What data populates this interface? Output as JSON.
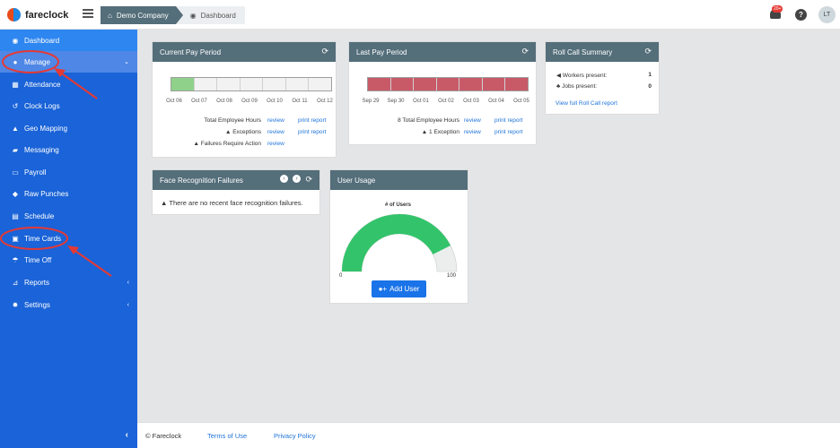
{
  "app": {
    "name": "fareclock"
  },
  "breadcrumb": {
    "company": "Demo Company",
    "page": "Dashboard"
  },
  "header": {
    "notification_count": "20+",
    "help_label": "?",
    "user_initials": "LT"
  },
  "sidebar": {
    "items": [
      {
        "label": "Dashboard",
        "icon": "dashboard-icon"
      },
      {
        "label": "Manage",
        "icon": "user-icon",
        "caret": "⌄"
      },
      {
        "label": "Attendance",
        "icon": "attendance-icon"
      },
      {
        "label": "Clock Logs",
        "icon": "history-icon"
      },
      {
        "label": "Geo Mapping",
        "icon": "map-icon"
      },
      {
        "label": "Messaging",
        "icon": "chat-icon"
      },
      {
        "label": "Payroll",
        "icon": "payroll-icon"
      },
      {
        "label": "Raw Punches",
        "icon": "car-icon"
      },
      {
        "label": "Schedule",
        "icon": "calendar-icon"
      },
      {
        "label": "Time Cards",
        "icon": "card-icon"
      },
      {
        "label": "Time Off",
        "icon": "beach-icon"
      },
      {
        "label": "Reports",
        "icon": "chart-icon",
        "caret": "‹"
      },
      {
        "label": "Settings",
        "icon": "gear-icon",
        "caret": "‹"
      }
    ],
    "collapse": "‹"
  },
  "current_pay_period": {
    "title": "Current Pay Period",
    "days": [
      "Oct 06",
      "Oct 07",
      "Oct 08",
      "Oct 09",
      "Oct 10",
      "Oct 11",
      "Oct 12"
    ],
    "progress": 1,
    "total_hours_label": "Total Employee Hours",
    "exceptions_label": "Exceptions",
    "failures_label": "Failures Require Action",
    "review_label": "review",
    "print_label": "print report"
  },
  "last_pay_period": {
    "title": "Last Pay Period",
    "days": [
      "Sep 29",
      "Sep 30",
      "Oct 01",
      "Oct 02",
      "Oct 03",
      "Oct 04",
      "Oct 05"
    ],
    "progress": 7,
    "total_hours_label": "8 Total Employee Hours",
    "exceptions_label": "1 Exception",
    "review_label": "review",
    "print_label": "print report"
  },
  "roll_call": {
    "title": "Roll Call Summary",
    "workers_label": "Workers present:",
    "workers_value": "1",
    "jobs_label": "Jobs present:",
    "jobs_value": "0",
    "link": "View full Roll Call report"
  },
  "face_recognition": {
    "title": "Face Recognition Failures",
    "message": "There are no recent face recognition failures."
  },
  "user_usage": {
    "title": "User Usage",
    "gauge_title": "# of Users",
    "min": "0",
    "max": "100",
    "value": 85,
    "button": "Add User"
  },
  "footer": {
    "copyright": "© Fareclock",
    "terms": "Terms of Use",
    "privacy": "Privacy Policy"
  },
  "colors": {
    "sidebar": "#1a63d8",
    "card_header": "#546e7a",
    "green": "#33c46b",
    "red": "#c85a68",
    "link": "#1e73d8"
  }
}
